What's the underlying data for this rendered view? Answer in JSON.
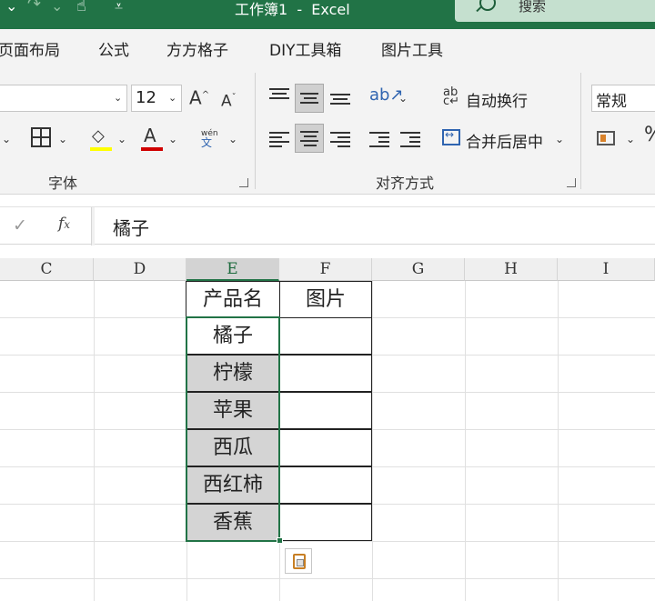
{
  "app": {
    "title": "工作簿1  -  Excel",
    "search_label": "搜索",
    "accent": "#217346"
  },
  "menu_tabs": [
    "页面布局",
    "公式",
    "方方格子",
    "DIY工具箱",
    "图片工具"
  ],
  "ribbon": {
    "font_size": "12",
    "wrap_text_label": "自动换行",
    "merge_center_label": "合并后居中",
    "number_format": "常规",
    "group_font_label": "字体",
    "group_align_label": "对齐方式",
    "font_color": "#c00000",
    "highlight_color": "#ffff00"
  },
  "formula_bar": {
    "value": "橘子"
  },
  "columns": [
    "C",
    "D",
    "E",
    "F",
    "G",
    "H",
    "I"
  ],
  "selected_column": "E",
  "table": {
    "headers": [
      "产品名",
      "图片"
    ],
    "rows": [
      "橘子",
      "柠檬",
      "苹果",
      "西瓜",
      "西红柿",
      "香蕉"
    ]
  }
}
